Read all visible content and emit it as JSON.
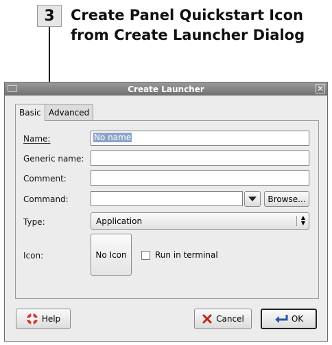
{
  "callout": {
    "step": "3",
    "title_line1": "Create Panel Quickstart Icon",
    "title_line2": "from Create Launcher Dialog"
  },
  "window": {
    "title": "Create Launcher",
    "close_glyph": "✕"
  },
  "tabs": [
    {
      "label": "Basic",
      "active": true
    },
    {
      "label": "Advanced",
      "active": false
    }
  ],
  "form": {
    "name_label": "Name:",
    "name_value": "No name",
    "generic_label": "Generic name:",
    "generic_value": "",
    "comment_label": "Comment:",
    "comment_value": "",
    "command_label": "Command:",
    "command_value": "",
    "browse_label": "Browse...",
    "type_label": "Type:",
    "type_value": "Application",
    "icon_label": "Icon:",
    "icon_button": "No Icon",
    "terminal_label": "Run in terminal",
    "terminal_checked": false
  },
  "buttons": {
    "help": "Help",
    "cancel": "Cancel",
    "ok": "OK"
  },
  "icons": {
    "help": "lifebuoy-icon",
    "cancel": "cancel-x-icon",
    "ok": "ok-arrow-icon",
    "combo": "triangle-down-icon"
  }
}
